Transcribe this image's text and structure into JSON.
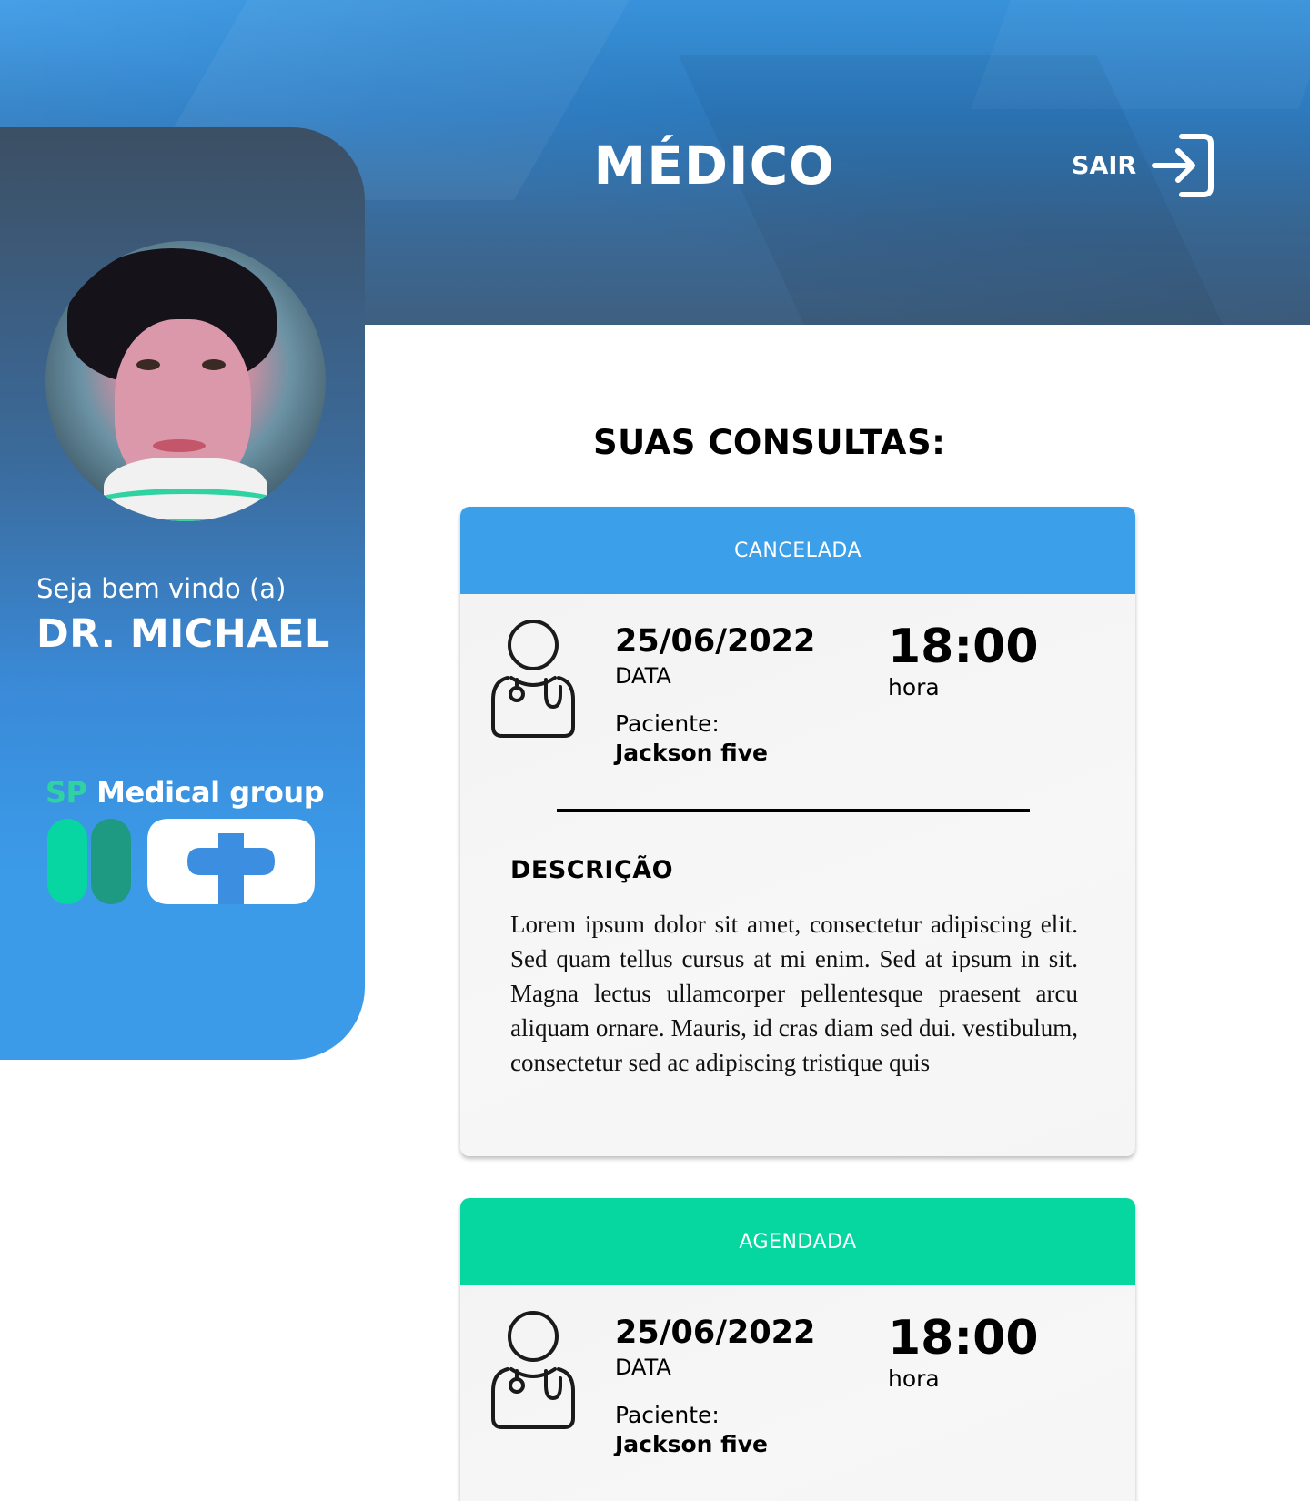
{
  "header": {
    "title": "MÉDICO",
    "logout_label": "SAIR"
  },
  "sidebar": {
    "welcome": "Seja bem vindo (a)",
    "doctor_name": "DR. MICHAEL",
    "brand": {
      "prefix": "SP",
      "name": " Medical group"
    }
  },
  "main": {
    "section_title": "SUAS CONSULTAS:",
    "appointments": [
      {
        "status": "CANCELADA",
        "status_color": "#3b9fea",
        "date": "25/06/2022",
        "date_label": "DATA",
        "time": "18:00",
        "time_label": "hora",
        "patient_label": "Paciente:",
        "patient_name": "Jackson five",
        "description_title": "DESCRIÇÃO",
        "description": "Lorem ipsum dolor sit amet, consectetur adipiscing elit. Sed quam tellus cursus at mi enim. Sed at ipsum in sit. Magna lectus ullamcorper pellentesque praesent arcu aliquam ornare. Mauris, id cras diam sed dui. vestibulum, consectetur sed ac adipiscing tristique quis"
      },
      {
        "status": "AGENDADA",
        "status_color": "#06d6a0",
        "date": "25/06/2022",
        "date_label": "DATA",
        "time": "18:00",
        "time_label": "hora",
        "patient_label": "Paciente:",
        "patient_name": "Jackson five"
      }
    ]
  },
  "icons": {
    "logout": "logout-icon",
    "doctor": "doctor-icon",
    "avatar": "doctor-avatar",
    "logo": "sp-medical-group-logo"
  }
}
